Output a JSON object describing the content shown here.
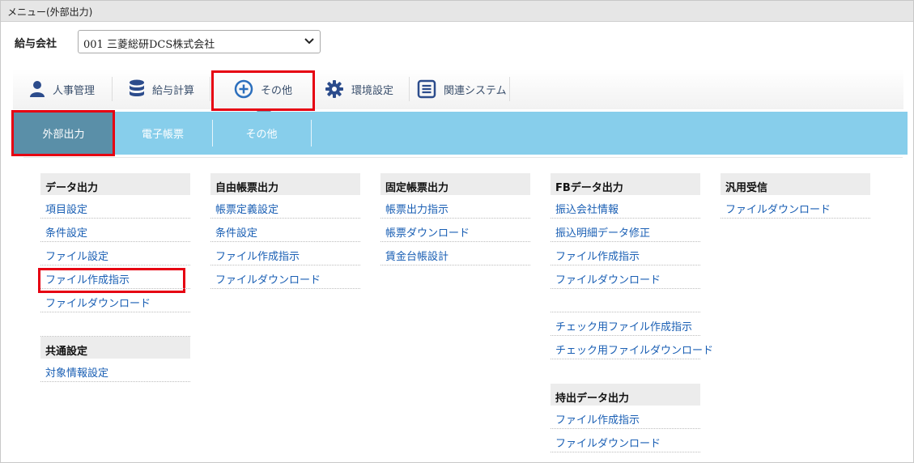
{
  "window": {
    "title": "メニュー(外部出力)"
  },
  "company": {
    "label": "給与会社",
    "selected": "001 三菱総研DCS株式会社"
  },
  "topnav": [
    {
      "label": "人事管理",
      "icon": "person-icon"
    },
    {
      "label": "給与計算",
      "icon": "database-icon"
    },
    {
      "label": "その他",
      "icon": "plus-circle-icon"
    },
    {
      "label": "環境設定",
      "icon": "gear-icon"
    },
    {
      "label": "関連システム",
      "icon": "document-list-icon"
    }
  ],
  "subnav": [
    {
      "label": "外部出力"
    },
    {
      "label": "電子帳票"
    },
    {
      "label": "その他"
    }
  ],
  "columns": [
    {
      "groups": [
        {
          "header": "データ出力",
          "links": [
            "項目設定",
            "条件設定",
            "ファイル設定",
            "ファイル作成指示",
            "ファイルダウンロード"
          ]
        },
        {
          "header": "共通設定",
          "links": [
            "対象情報設定"
          ]
        }
      ]
    },
    {
      "groups": [
        {
          "header": "自由帳票出力",
          "links": [
            "帳票定義設定",
            "条件設定",
            "ファイル作成指示",
            "ファイルダウンロード"
          ]
        }
      ]
    },
    {
      "groups": [
        {
          "header": "固定帳票出力",
          "links": [
            "帳票出力指示",
            "帳票ダウンロード",
            "賃金台帳設計"
          ]
        }
      ]
    },
    {
      "groups": [
        {
          "header": "FBデータ出力",
          "links": [
            "振込会社情報",
            "振込明細データ修正",
            "ファイル作成指示",
            "ファイルダウンロード",
            "",
            "チェック用ファイル作成指示",
            "チェック用ファイルダウンロード"
          ]
        },
        {
          "header": "持出データ出力",
          "links": [
            "ファイル作成指示",
            "ファイルダウンロード"
          ]
        }
      ]
    },
    {
      "groups": [
        {
          "header": "汎用受信",
          "links": [
            "ファイルダウンロード"
          ]
        }
      ]
    }
  ],
  "colors": {
    "accent": "#87ceeb",
    "active_tab": "#5a8fa8",
    "link": "#1a5fb4",
    "highlight": "#e60012",
    "nav_text": "#3a4f6c"
  }
}
